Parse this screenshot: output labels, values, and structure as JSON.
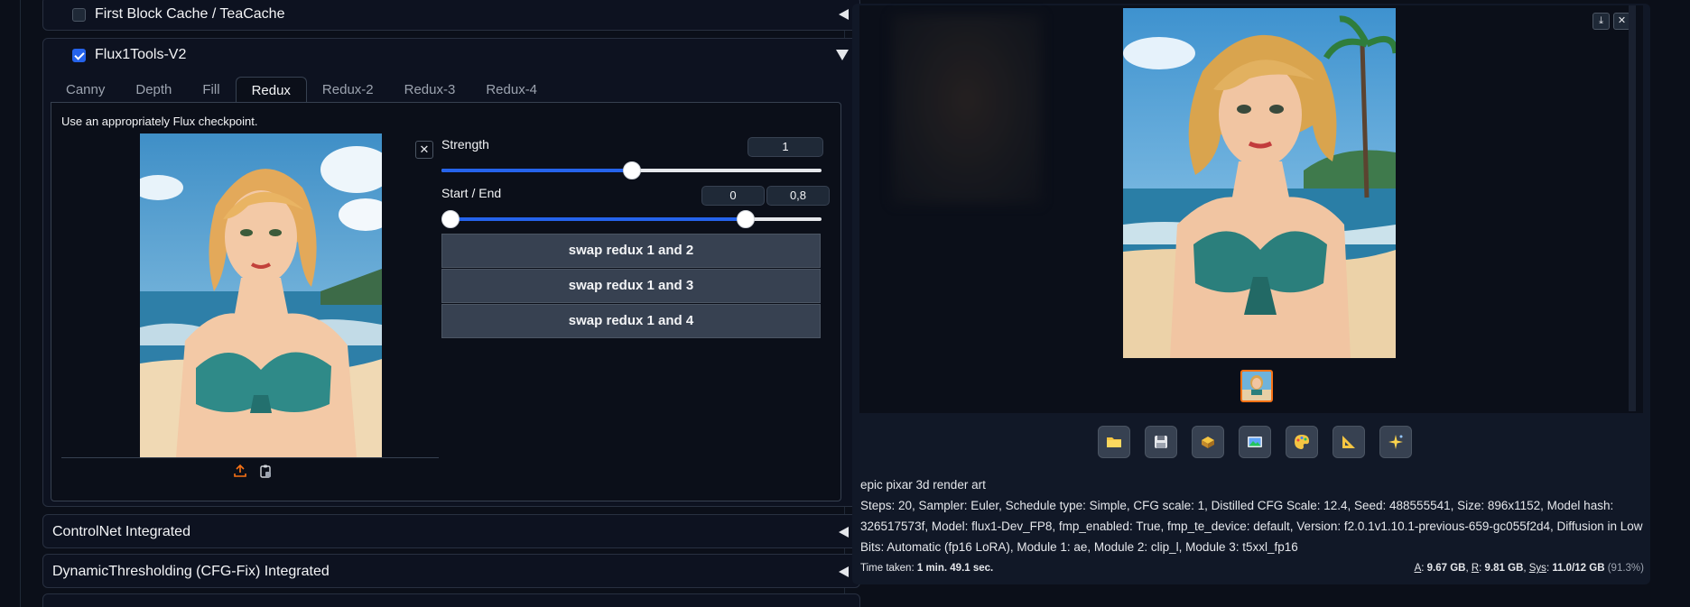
{
  "accordions": {
    "first_block_cache": {
      "title": "First Block Cache / TeaCache",
      "checked": false
    },
    "flux1tools": {
      "title": "Flux1Tools-V2",
      "checked": true
    },
    "controlnet": {
      "title": "ControlNet Integrated"
    },
    "dynamic_thresholding": {
      "title": "DynamicThresholding (CFG-Fix) Integrated"
    }
  },
  "tabs": [
    {
      "label": "Canny"
    },
    {
      "label": "Depth"
    },
    {
      "label": "Fill"
    },
    {
      "label": "Redux",
      "active": true
    },
    {
      "label": "Redux-2"
    },
    {
      "label": "Redux-3"
    },
    {
      "label": "Redux-4"
    }
  ],
  "redux": {
    "hint": "Use an appropriately Flux checkpoint.",
    "clear_icon": "✕",
    "strength": {
      "label": "Strength",
      "value": "1",
      "fraction": 0.5
    },
    "start_end": {
      "label": "Start / End",
      "start": "0",
      "end": "0,8",
      "start_fraction": 0.0,
      "end_fraction": 0.8
    },
    "buttons": {
      "swap12": "swap redux 1 and 2",
      "swap13": "swap redux 1 and 3",
      "swap14": "swap redux 1 and 4"
    }
  },
  "output": {
    "prompt": "epic pixar 3d render art",
    "params": "Steps: 20, Sampler: Euler, Schedule type: Simple, CFG scale: 1, Distilled CFG Scale: 12.4, Seed: 488555541, Size: 896x1152, Model hash: 326517573f, Model: flux1-Dev_FP8, fmp_enabled: True, fmp_te_device: default, Version: f2.0.1v1.10.1-previous-659-gc055f2d4, Diffusion in Low Bits: Automatic (fp16 LoRA), Module 1: ae, Module 2: clip_l, Module 3: t5xxl_fp16",
    "time_label": "Time taken:",
    "time_value": "1 min. 49.1 sec.",
    "mem_a_label": "A",
    "mem_a": "9.67 GB",
    "mem_r_label": "R",
    "mem_r": "9.81 GB",
    "mem_sys_label": "Sys",
    "mem_sys": "11.0/12 GB",
    "mem_pct": "(91.3%)"
  },
  "toolbar_icons": [
    "folder-icon",
    "save-icon",
    "zip-icon",
    "image-icon",
    "palette-icon",
    "ruler-icon",
    "sparkle-icon"
  ],
  "colors": {
    "accent": "#2563eb",
    "thumb_border": "#f97316",
    "panel": "#111827",
    "background": "#0b0f19"
  }
}
